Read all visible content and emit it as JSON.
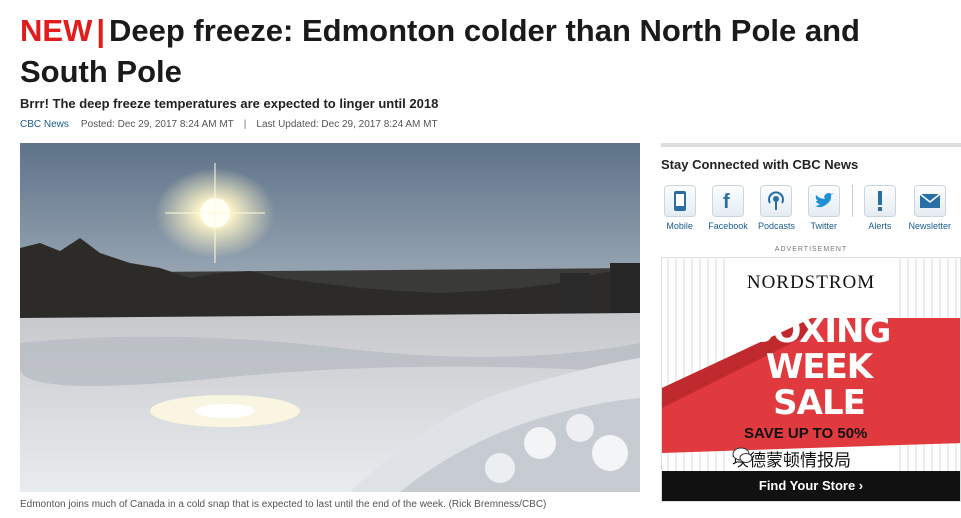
{
  "article": {
    "badge": "NEW",
    "separator": "|",
    "title": "Deep freeze: Edmonton colder than North Pole and South Pole",
    "subtitle": "Brrr! The deep freeze temperatures are expected to linger until 2018",
    "source": "CBC News",
    "posted": "Posted: Dec 29, 2017 8:24 AM MT",
    "pipe": "|",
    "updated": "Last Updated: Dec 29, 2017 8:24 AM MT",
    "caption": "Edmonton joins much of Canada in a cold snap that is expected to last until the end of the week. (Rick Bremness/CBC)"
  },
  "sidebar": {
    "stay_title": "Stay Connected with CBC News",
    "social": [
      {
        "label": "Mobile",
        "icon": "mobile-icon"
      },
      {
        "label": "Facebook",
        "icon": "facebook-icon"
      },
      {
        "label": "Podcasts",
        "icon": "podcast-icon"
      },
      {
        "label": "Twitter",
        "icon": "twitter-icon"
      },
      {
        "label": "Alerts",
        "icon": "alert-icon"
      },
      {
        "label": "Newsletter",
        "icon": "newsletter-icon"
      }
    ],
    "ad_label": "ADVERTISEMENT",
    "ad": {
      "brand": "NORDSTROM",
      "line1": "BOXING",
      "line2": "WEEK",
      "line3": "SALE",
      "save": "SAVE UP TO 50%",
      "watermark": "埃德蒙顿情报局",
      "cta": "Find Your Store ›"
    }
  },
  "colors": {
    "accent_red": "#e21b1b",
    "link_blue": "#1a5b8e",
    "ad_red": "#e03a3e"
  }
}
